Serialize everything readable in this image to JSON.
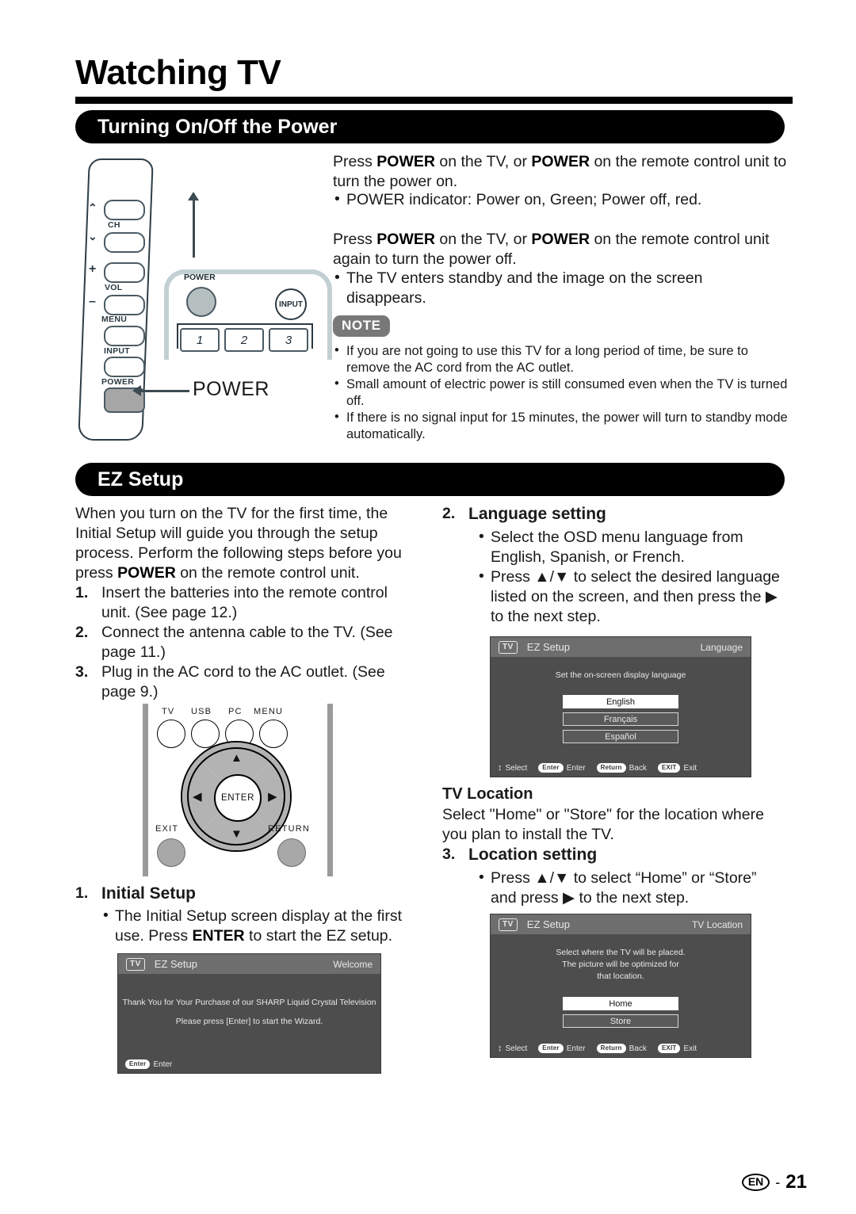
{
  "page": {
    "title": "Watching TV",
    "footer_language": "EN",
    "footer_dash": "-",
    "footer_page": "21"
  },
  "sections": {
    "power": {
      "heading": "Turning On/Off the Power"
    },
    "ez": {
      "heading": "EZ Setup"
    }
  },
  "power_section": {
    "para1_a": "Press ",
    "para1_b": "POWER",
    "para1_c": " on the TV, or ",
    "para1_d": "POWER",
    "para1_e": " on the remote control unit to turn the power on.",
    "bullet1": "POWER indicator: Power on, Green; Power off, red.",
    "para2_a": "Press ",
    "para2_b": "POWER",
    "para2_c": " on the TV, or ",
    "para2_d": "POWER",
    "para2_e": " on the remote control unit again to turn the power off.",
    "bullet2": "The TV enters standby and the image on the screen disappears.",
    "note_label": "NOTE",
    "notes": [
      "If you are not going to use this TV for a long period of time, be sure to remove the AC cord from the AC outlet.",
      "Small amount of electric power is still consumed even when the TV is turned off.",
      "If there is no signal input for 15 minutes, the power will turn to standby mode automatically."
    ]
  },
  "tv_panel": {
    "ch_label": "CH",
    "vol_label": "VOL",
    "menu_label": "MENU",
    "input_label": "INPUT",
    "power_label": "POWER",
    "chev_up": "⌃",
    "chev_down": "⌄",
    "plus": "+",
    "minus": "–",
    "bezel_power_label": "POWER",
    "bezel_input_label": "INPUT",
    "num_keys": [
      "1",
      "2",
      "3"
    ],
    "callout": "POWER"
  },
  "ez_section": {
    "intro_a": "When you turn on the TV for the first time, the Initial Setup will guide you through the setup process. Perform the following steps before you press ",
    "intro_b": "POWER",
    "intro_c": " on the remote control unit.",
    "steps": [
      {
        "num": "1.",
        "text": "Insert the batteries into the remote control unit. (See page 12.)"
      },
      {
        "num": "2.",
        "text": "Connect the antenna cable to the TV. (See page 11.)"
      },
      {
        "num": "3.",
        "text": "Plug in the AC cord to the AC outlet. (See page 9.)"
      }
    ]
  },
  "remote": {
    "buttons": [
      "TV",
      "USB",
      "PC",
      "MENU"
    ],
    "enter": "ENTER",
    "exit": "EXIT",
    "return": "RETURN",
    "arrow_up": "▲",
    "arrow_down": "▼",
    "arrow_left": "◀",
    "arrow_right": "▶"
  },
  "step1": {
    "num": "1.",
    "heading": "Initial Setup",
    "bullet_a": "The Initial Setup screen display at the first use. Press ",
    "bullet_b": "ENTER",
    "bullet_c": " to start the EZ setup."
  },
  "step2": {
    "num": "2.",
    "heading": "Language setting",
    "bullets": [
      "Select the OSD menu language from English, Spanish, or French.",
      "Press ▲/▼ to select the desired language listed on the screen, and then press the ▶ to the next step."
    ]
  },
  "tv_location_text": {
    "heading": "TV Location",
    "body": "Select \"Home\" or \"Store\" for the location where you plan to install the TV."
  },
  "step3": {
    "num": "3.",
    "heading": "Location setting",
    "bullets": [
      "Press ▲/▼ to select “Home” or “Store” and press ▶ to the next step."
    ]
  },
  "osd_welcome": {
    "badge": "TV",
    "title": "EZ Setup",
    "right": "Welcome",
    "line1": "Thank You for Your Purchase of our SHARP Liquid Crystal Television",
    "line2": "Please press [Enter] to start the Wizard.",
    "foot": [
      {
        "chip": "Enter",
        "label": "Enter"
      }
    ]
  },
  "osd_language": {
    "badge": "TV",
    "title": "EZ Setup",
    "right": "Language",
    "prompt": "Set the on-screen display language",
    "options": [
      {
        "label": "English",
        "selected": true
      },
      {
        "label": "Français",
        "selected": false
      },
      {
        "label": "Español",
        "selected": false
      }
    ],
    "foot": [
      {
        "chip": "↕",
        "label": "Select",
        "plain": true
      },
      {
        "chip": "Enter",
        "label": "Enter"
      },
      {
        "chip": "Return",
        "label": "Back"
      },
      {
        "chip": "EXIT",
        "label": "Exit"
      }
    ]
  },
  "osd_location": {
    "badge": "TV",
    "title": "EZ Setup",
    "right": "TV Location",
    "prompt_l1": "Select where the TV will be placed.",
    "prompt_l2": "The picture will be optimized for",
    "prompt_l3": "that location.",
    "options": [
      {
        "label": "Home",
        "selected": true
      },
      {
        "label": "Store",
        "selected": false
      }
    ],
    "foot": [
      {
        "chip": "↕",
        "label": "Select",
        "plain": true
      },
      {
        "chip": "Enter",
        "label": "Enter"
      },
      {
        "chip": "Return",
        "label": "Back"
      },
      {
        "chip": "EXIT",
        "label": "Exit"
      }
    ]
  },
  "colors": {
    "bar": "#000000",
    "note_badge": "#787878",
    "osd_body": "#4d4d4d",
    "osd_head": "#6e6e6e",
    "illustration_outline": "#2e3d46"
  }
}
